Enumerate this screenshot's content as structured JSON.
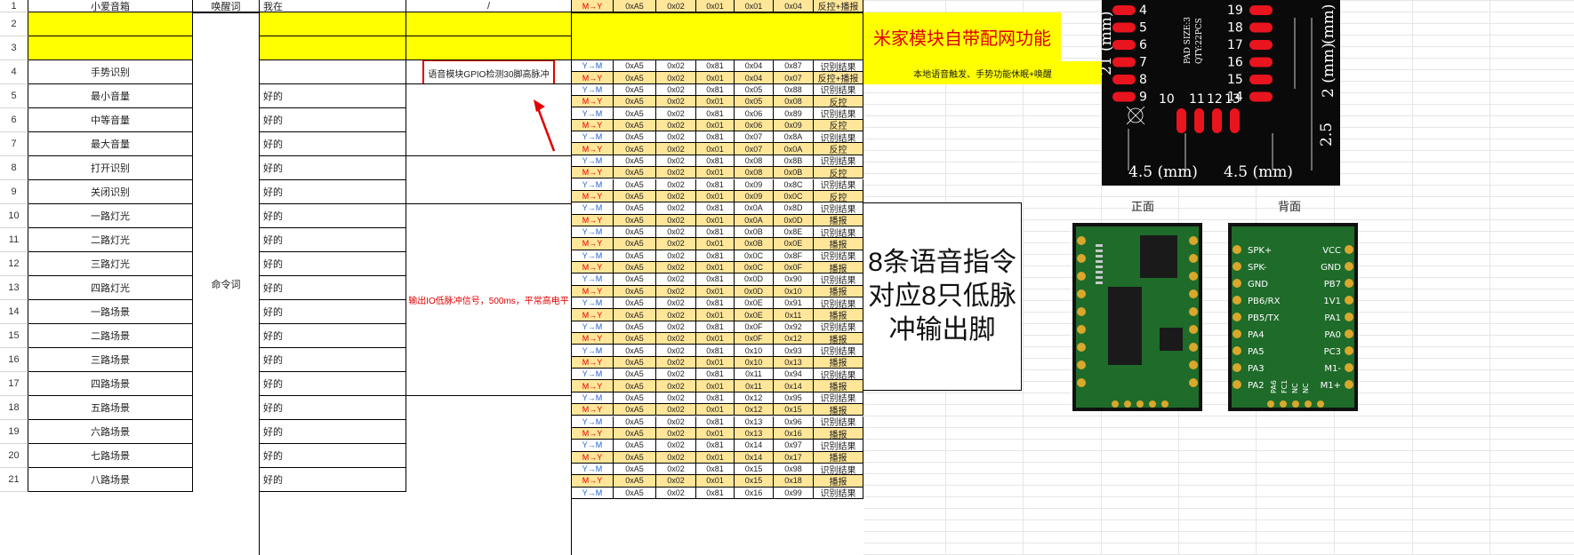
{
  "row_numbers": [
    "1",
    "2",
    "3",
    "4",
    "5",
    "6",
    "7",
    "8",
    "9",
    "10",
    "11",
    "12",
    "13",
    "14",
    "15",
    "16",
    "17",
    "18",
    "19",
    "20",
    "21"
  ],
  "row1": {
    "command": "小爱音箱",
    "type": "唤醒词",
    "reply": "我在",
    "note": "/"
  },
  "row4": {
    "command": "手势识别",
    "note": "语音模块GPIO检测30脚高脉冲"
  },
  "merged": {
    "cmd_type": "命令词",
    "pulse_note": "输出IO低脉冲信号，500ms，平常高电平"
  },
  "commands": [
    {
      "name": "最小音量",
      "reply": "好的"
    },
    {
      "name": "中等音量",
      "reply": "好的"
    },
    {
      "name": "最大音量",
      "reply": "好的"
    },
    {
      "name": "打开识别",
      "reply": "好的"
    },
    {
      "name": "关闭识别",
      "reply": "好的"
    },
    {
      "name": "一路灯光",
      "reply": "好的"
    },
    {
      "name": "二路灯光",
      "reply": "好的"
    },
    {
      "name": "三路灯光",
      "reply": "好的"
    },
    {
      "name": "四路灯光",
      "reply": "好的"
    },
    {
      "name": "一路场景",
      "reply": "好的"
    },
    {
      "name": "二路场景",
      "reply": "好的"
    },
    {
      "name": "三路场景",
      "reply": "好的"
    },
    {
      "name": "四路场景",
      "reply": "好的"
    },
    {
      "name": "五路场景",
      "reply": "好的"
    },
    {
      "name": "六路场景",
      "reply": "好的"
    },
    {
      "name": "七路场景",
      "reply": "好的"
    },
    {
      "name": "八路场景",
      "reply": "好的"
    }
  ],
  "hex_rows": [
    {
      "dir": "M→Y",
      "b": [
        "0xA5",
        "0x02",
        "0x01",
        "0x01",
        "0x04"
      ],
      "r": "反控+播报"
    },
    {
      "dir": "Y→M",
      "b": [
        "0xA5",
        "0x02",
        "0x81",
        "0x04",
        "0x87"
      ],
      "r": "识别结果"
    },
    {
      "dir": "M→Y",
      "b": [
        "0xA5",
        "0x02",
        "0x01",
        "0x04",
        "0x07"
      ],
      "r": "反控+播报"
    },
    {
      "dir": "Y→M",
      "b": [
        "0xA5",
        "0x02",
        "0x81",
        "0x05",
        "0x88"
      ],
      "r": "识别结果"
    },
    {
      "dir": "M→Y",
      "b": [
        "0xA5",
        "0x02",
        "0x01",
        "0x05",
        "0x08"
      ],
      "r": "反控"
    },
    {
      "dir": "Y→M",
      "b": [
        "0xA5",
        "0x02",
        "0x81",
        "0x06",
        "0x89"
      ],
      "r": "识别结果"
    },
    {
      "dir": "M→Y",
      "b": [
        "0xA5",
        "0x02",
        "0x01",
        "0x06",
        "0x09"
      ],
      "r": "反控"
    },
    {
      "dir": "Y→M",
      "b": [
        "0xA5",
        "0x02",
        "0x81",
        "0x07",
        "0x8A"
      ],
      "r": "识别结果"
    },
    {
      "dir": "M→Y",
      "b": [
        "0xA5",
        "0x02",
        "0x01",
        "0x07",
        "0x0A"
      ],
      "r": "反控"
    },
    {
      "dir": "Y→M",
      "b": [
        "0xA5",
        "0x02",
        "0x81",
        "0x08",
        "0x8B"
      ],
      "r": "识别结果"
    },
    {
      "dir": "M→Y",
      "b": [
        "0xA5",
        "0x02",
        "0x01",
        "0x08",
        "0x0B"
      ],
      "r": "反控"
    },
    {
      "dir": "Y→M",
      "b": [
        "0xA5",
        "0x02",
        "0x81",
        "0x09",
        "0x8C"
      ],
      "r": "识别结果"
    },
    {
      "dir": "M→Y",
      "b": [
        "0xA5",
        "0x02",
        "0x01",
        "0x09",
        "0x0C"
      ],
      "r": "反控"
    },
    {
      "dir": "Y→M",
      "b": [
        "0xA5",
        "0x02",
        "0x81",
        "0x0A",
        "0x8D"
      ],
      "r": "识别结果"
    },
    {
      "dir": "M→Y",
      "b": [
        "0xA5",
        "0x02",
        "0x01",
        "0x0A",
        "0x0D"
      ],
      "r": "播报"
    },
    {
      "dir": "Y→M",
      "b": [
        "0xA5",
        "0x02",
        "0x81",
        "0x0B",
        "0x8E"
      ],
      "r": "识别结果"
    },
    {
      "dir": "M→Y",
      "b": [
        "0xA5",
        "0x02",
        "0x01",
        "0x0B",
        "0x0E"
      ],
      "r": "播报"
    },
    {
      "dir": "Y→M",
      "b": [
        "0xA5",
        "0x02",
        "0x81",
        "0x0C",
        "0x8F"
      ],
      "r": "识别结果"
    },
    {
      "dir": "M→Y",
      "b": [
        "0xA5",
        "0x02",
        "0x01",
        "0x0C",
        "0x0F"
      ],
      "r": "播报"
    },
    {
      "dir": "Y→M",
      "b": [
        "0xA5",
        "0x02",
        "0x81",
        "0x0D",
        "0x90"
      ],
      "r": "识别结果"
    },
    {
      "dir": "M→Y",
      "b": [
        "0xA5",
        "0x02",
        "0x01",
        "0x0D",
        "0x10"
      ],
      "r": "播报"
    },
    {
      "dir": "Y→M",
      "b": [
        "0xA5",
        "0x02",
        "0x81",
        "0x0E",
        "0x91"
      ],
      "r": "识别结果"
    },
    {
      "dir": "M→Y",
      "b": [
        "0xA5",
        "0x02",
        "0x01",
        "0x0E",
        "0x11"
      ],
      "r": "播报"
    },
    {
      "dir": "Y→M",
      "b": [
        "0xA5",
        "0x02",
        "0x81",
        "0x0F",
        "0x92"
      ],
      "r": "识别结果"
    },
    {
      "dir": "M→Y",
      "b": [
        "0xA5",
        "0x02",
        "0x01",
        "0x0F",
        "0x12"
      ],
      "r": "播报"
    },
    {
      "dir": "Y→M",
      "b": [
        "0xA5",
        "0x02",
        "0x81",
        "0x10",
        "0x93"
      ],
      "r": "识别结果"
    },
    {
      "dir": "M→Y",
      "b": [
        "0xA5",
        "0x02",
        "0x01",
        "0x10",
        "0x13"
      ],
      "r": "播报"
    },
    {
      "dir": "Y→M",
      "b": [
        "0xA5",
        "0x02",
        "0x81",
        "0x11",
        "0x94"
      ],
      "r": "识别结果"
    },
    {
      "dir": "M→Y",
      "b": [
        "0xA5",
        "0x02",
        "0x01",
        "0x11",
        "0x14"
      ],
      "r": "播报"
    },
    {
      "dir": "Y→M",
      "b": [
        "0xA5",
        "0x02",
        "0x81",
        "0x12",
        "0x95"
      ],
      "r": "识别结果"
    },
    {
      "dir": "M→Y",
      "b": [
        "0xA5",
        "0x02",
        "0x01",
        "0x12",
        "0x15"
      ],
      "r": "播报"
    },
    {
      "dir": "Y→M",
      "b": [
        "0xA5",
        "0x02",
        "0x81",
        "0x13",
        "0x96"
      ],
      "r": "识别结果"
    },
    {
      "dir": "M→Y",
      "b": [
        "0xA5",
        "0x02",
        "0x01",
        "0x13",
        "0x16"
      ],
      "r": "播报"
    },
    {
      "dir": "Y→M",
      "b": [
        "0xA5",
        "0x02",
        "0x81",
        "0x14",
        "0x97"
      ],
      "r": "识别结果"
    },
    {
      "dir": "M→Y",
      "b": [
        "0xA5",
        "0x02",
        "0x01",
        "0x14",
        "0x17"
      ],
      "r": "播报"
    },
    {
      "dir": "Y→M",
      "b": [
        "0xA5",
        "0x02",
        "0x81",
        "0x15",
        "0x98"
      ],
      "r": "识别结果"
    },
    {
      "dir": "M→Y",
      "b": [
        "0xA5",
        "0x02",
        "0x01",
        "0x15",
        "0x18"
      ],
      "r": "播报"
    },
    {
      "dir": "Y→M",
      "b": [
        "0xA5",
        "0x02",
        "0x81",
        "0x16",
        "0x99"
      ],
      "r": "识别结果"
    }
  ],
  "notes": {
    "mijia": "米家模块自带配网功能",
    "local": "本地语音触发、手势功能休眠+唤醒",
    "eight_line1": "8条语音指令",
    "eight_line2": "对应8只低脉",
    "eight_line3": "冲输出脚"
  },
  "pcb_top": {
    "left_pins": [
      "4",
      "5",
      "6",
      "7",
      "8",
      "9"
    ],
    "right_pins": [
      "19",
      "18",
      "17",
      "16",
      "15",
      "14"
    ],
    "bottom_pins": [
      "10",
      "11",
      "12",
      "13"
    ],
    "pad_size": "PAD SIZE:3",
    "qty": "QTY:22PCS",
    "dim_left": "21 (mm)",
    "dim_right_top": "(mm)",
    "dim_right_mid": "2 (mm)",
    "dim_right_bot": "2.5",
    "dim_bottom_left": "4.5 (mm)",
    "dim_bottom_right": "4.5 (mm)"
  },
  "front_label": "正面",
  "back_label": "背面",
  "back_pins_left": [
    "SPK+",
    "SPK-",
    "GND",
    "PB6/RX",
    "PB5/TX",
    "PA4",
    "PA5",
    "PA3",
    "PA2"
  ],
  "back_pins_right": [
    "VCC",
    "GND",
    "PB7",
    "1V1",
    "PA1",
    "PA0",
    "PC3",
    "M1-",
    "M1+"
  ],
  "back_pins_bottom": [
    "PA6",
    "FC1",
    "NC",
    "NC"
  ],
  "colors": {
    "yellow": "#FFFF00",
    "hex_fill": "#FFE699",
    "blue_dir": "#1F5FD1",
    "red_dir": "#E00000",
    "pcb_black": "#0A0A0A",
    "pcb_pad": "#E8141E",
    "pcb_green": "#1F6B2A"
  }
}
